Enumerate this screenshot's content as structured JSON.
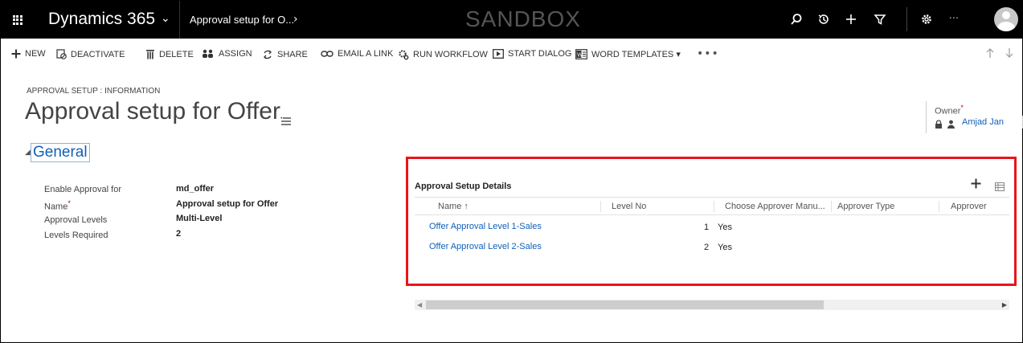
{
  "navbar": {
    "app_title": "Dynamics 365",
    "app_chevron": "⌄",
    "breadcrumb": "Approval setup for O...",
    "breadcrumb_chevron": "›",
    "environment": "SANDBOX",
    "more": "···"
  },
  "commands": [
    {
      "label": "NEW",
      "icon": "plus-icon"
    },
    {
      "label": "DEACTIVATE",
      "icon": "deactivate-icon"
    },
    {
      "label": "DELETE",
      "icon": "trash-icon"
    },
    {
      "label": "ASSIGN",
      "icon": "assign-icon"
    },
    {
      "label": "SHARE",
      "icon": "share-icon"
    },
    {
      "label": "EMAIL A LINK",
      "icon": "link-icon"
    },
    {
      "label": "RUN WORKFLOW",
      "icon": "workflow-icon"
    },
    {
      "label": "START DIALOG",
      "icon": "dialog-icon"
    },
    {
      "label": "WORD TEMPLATES ▾",
      "icon": "word-icon"
    }
  ],
  "command_more": "•••",
  "header": {
    "entity_label": "APPROVAL SETUP : INFORMATION",
    "title": "Approval setup for Offer",
    "owner_label": "Owner",
    "owner_required": "*",
    "owner_value": "Amjad Jan"
  },
  "section": {
    "title": "General",
    "caret": "◢"
  },
  "fields": [
    {
      "label": "Enable Approval for",
      "value": "md_offer",
      "required": ""
    },
    {
      "label": "Name",
      "value": "Approval setup for Offer",
      "required": "*"
    },
    {
      "label": "Approval Levels",
      "value": "Multi-Level",
      "required": ""
    },
    {
      "label": "Levels Required",
      "value": "2",
      "required": ""
    }
  ],
  "subgrid": {
    "title": "Approval Setup Details",
    "columns": [
      "Name ↑",
      "Level No",
      "Choose Approver Manu...",
      "Approver Type",
      "Approver"
    ],
    "rows": [
      {
        "name": "Offer Approval Level 1-Sales",
        "level": "1",
        "choose": "Yes"
      },
      {
        "name": "Offer Approval Level 2-Sales",
        "level": "2",
        "choose": "Yes"
      }
    ]
  },
  "colors": {
    "accent": "#1160b7",
    "highlight": "#e8151b",
    "navbar": "#000000"
  }
}
